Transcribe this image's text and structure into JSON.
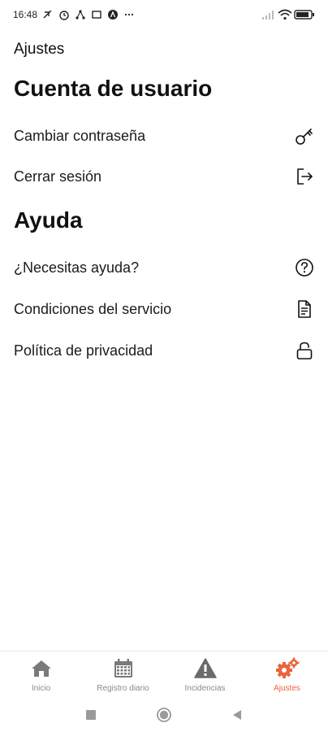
{
  "status_bar": {
    "time": "16:48",
    "battery_level": "full"
  },
  "header": {
    "title": "Ajustes"
  },
  "sections": {
    "account": {
      "title": "Cuenta de usuario",
      "items": [
        {
          "label": "Cambiar contraseña",
          "icon": "key-icon"
        },
        {
          "label": "Cerrar sesión",
          "icon": "logout-icon"
        }
      ]
    },
    "help": {
      "title": "Ayuda",
      "items": [
        {
          "label": "¿Necesitas ayuda?",
          "icon": "help-circle-icon"
        },
        {
          "label": "Condiciones del servicio",
          "icon": "document-icon"
        },
        {
          "label": "Política de privacidad",
          "icon": "lock-icon"
        }
      ]
    }
  },
  "bottom_nav": {
    "items": [
      {
        "label": "Inicio",
        "icon": "home-icon",
        "active": false
      },
      {
        "label": "Registro diario",
        "icon": "calendar-icon",
        "active": false
      },
      {
        "label": "Incidencias",
        "icon": "warning-icon",
        "active": false
      },
      {
        "label": "Ajustes",
        "icon": "gears-icon",
        "active": true
      }
    ],
    "active_color": "#e9653b",
    "inactive_color": "#8a8a8a"
  },
  "system_nav": {
    "buttons": [
      "recents",
      "home",
      "back"
    ]
  }
}
